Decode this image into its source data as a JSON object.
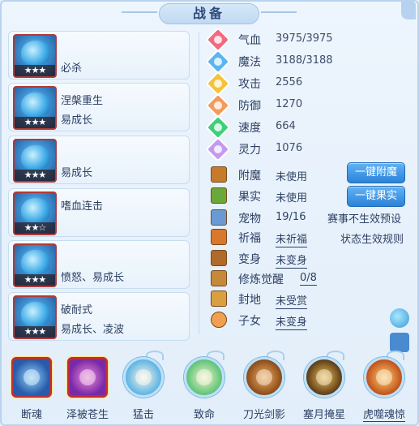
{
  "title": "战备",
  "pets": [
    {
      "stars": "★★★",
      "line1": "必杀",
      "line2": ""
    },
    {
      "stars": "★★★",
      "line1": "涅槃重生",
      "line2": "易成长"
    },
    {
      "stars": "★★★",
      "line1": "易成长",
      "line2": ""
    },
    {
      "stars": "★★☆",
      "line1": "嗜血连击",
      "line2": ""
    },
    {
      "stars": "★★★",
      "line1": "愤怒、易成长",
      "line2": ""
    },
    {
      "stars": "★★★",
      "line1": "破耐式",
      "line2": "易成长、凌波"
    }
  ],
  "stats": [
    {
      "label": "气血",
      "value": "3975/3975",
      "icon": "heart-icon",
      "color": "#f06a80"
    },
    {
      "label": "魔法",
      "value": "3188/3188",
      "icon": "mana-icon",
      "color": "#5ab6f2"
    },
    {
      "label": "攻击",
      "value": "2556",
      "icon": "attack-icon",
      "color": "#f5c23a"
    },
    {
      "label": "防御",
      "value": "1270",
      "icon": "shield-icon",
      "color": "#f59a5a"
    },
    {
      "label": "速度",
      "value": "664",
      "icon": "speed-icon",
      "color": "#3fcf7a"
    },
    {
      "label": "灵力",
      "value": "1076",
      "icon": "spirit-icon",
      "color": "#c49af0"
    }
  ],
  "items": [
    {
      "label": "附魔",
      "value": "未使用",
      "underline": false,
      "icon": "enchant-icon",
      "color": "#c77a2a"
    },
    {
      "label": "果实",
      "value": "未使用",
      "underline": false,
      "icon": "fruit-icon",
      "color": "#6aa83a"
    },
    {
      "label": "宠物",
      "value": "19/16",
      "underline": false,
      "icon": "pet-icon",
      "color": "#6a9ad6"
    },
    {
      "label": "祈福",
      "value": "未祈福",
      "underline": true,
      "icon": "blessing-icon",
      "color": "#d9772a"
    },
    {
      "label": "变身",
      "value": "未变身",
      "underline": true,
      "icon": "transform-icon",
      "color": "#b06a2a"
    },
    {
      "label": "修炼觉醒",
      "value": "0/8",
      "underline": true,
      "icon": "cultivate-icon",
      "color": "#c48a3a"
    },
    {
      "label": "封地",
      "value": "未受赏",
      "underline": true,
      "icon": "fief-icon",
      "color": "#d9a040"
    },
    {
      "label": "子女",
      "value": "未变身",
      "underline": true,
      "icon": "child-icon",
      "color": "#f0a050"
    }
  ],
  "buttons": {
    "enchant_all": "一键附魔",
    "fruit_all": "一键果实"
  },
  "links": {
    "event_preset": "赛事不生效预设",
    "status_rules": "状态生效规则"
  },
  "skills": [
    {
      "name": "断魂",
      "style": "square",
      "underline": false,
      "color1": "#8fd4ff",
      "color2": "#2a5aa8"
    },
    {
      "name": "泽被苍生",
      "style": "square",
      "underline": false,
      "color1": "#f08ad8",
      "color2": "#7a2aa8"
    },
    {
      "name": "猛击",
      "style": "round",
      "underline": false,
      "color1": "#fff4e0",
      "color2": "#5ab4e6"
    },
    {
      "name": "致命",
      "style": "round",
      "underline": false,
      "color1": "#f7f0c0",
      "color2": "#5ac47a"
    },
    {
      "name": "刀光剑影",
      "style": "round",
      "underline": false,
      "color1": "#f0b060",
      "color2": "#8a4a1a"
    },
    {
      "name": "塞月掩星",
      "style": "round",
      "underline": false,
      "color1": "#f0c050",
      "color2": "#5a3a1a"
    },
    {
      "name": "虎噬魂惊",
      "style": "round",
      "underline": true,
      "color1": "#ffd070",
      "color2": "#c0501a"
    }
  ]
}
